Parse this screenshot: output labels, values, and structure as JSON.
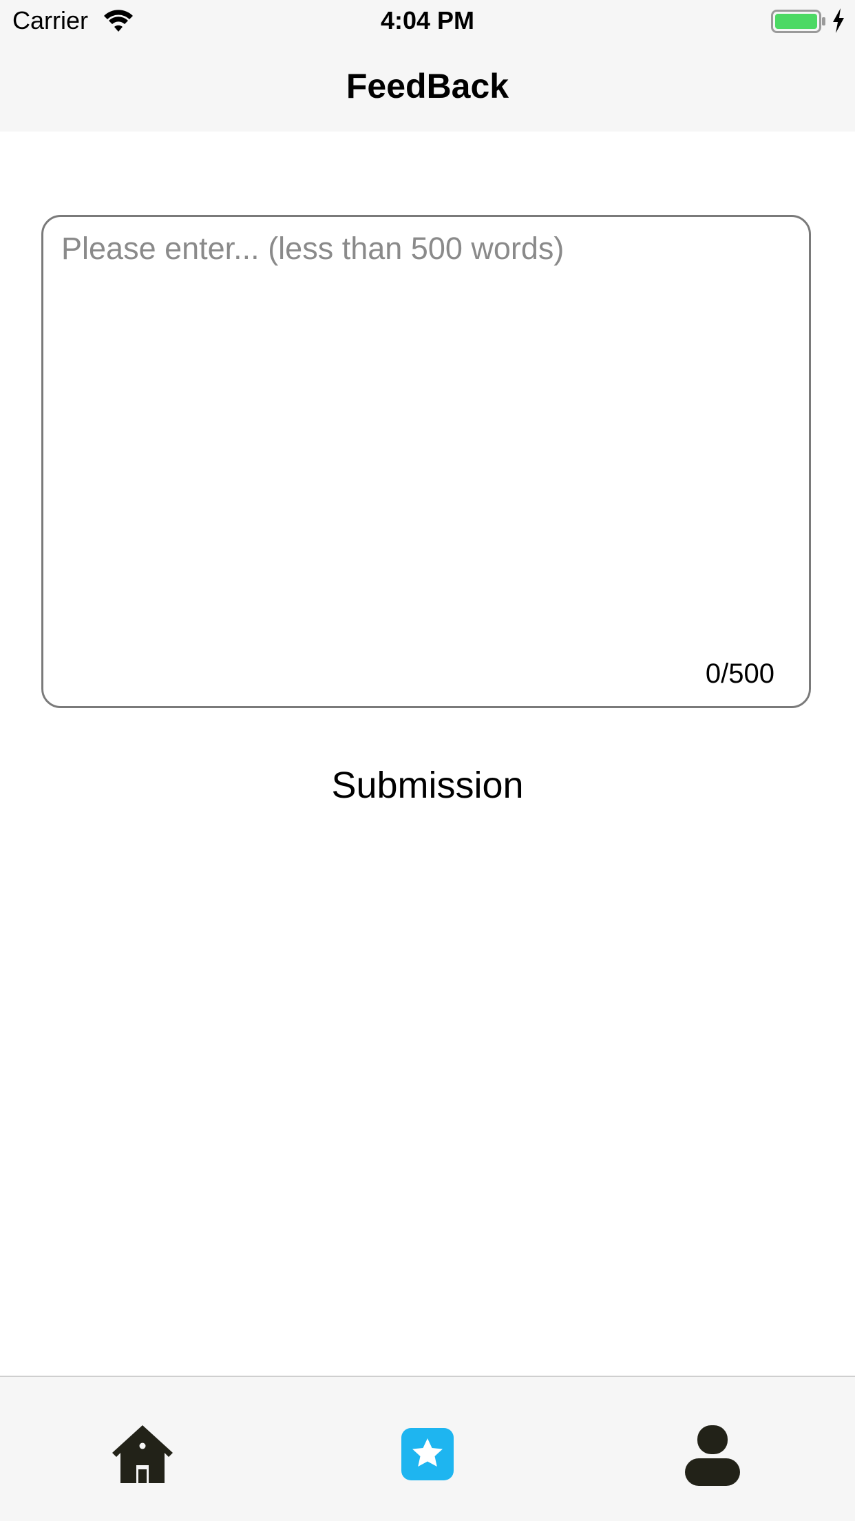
{
  "status_bar": {
    "carrier": "Carrier",
    "time": "4:04 PM",
    "icons": [
      "wifi-icon",
      "battery-icon",
      "charging-icon"
    ],
    "battery_color": "#4cd964"
  },
  "nav": {
    "title": "FeedBack"
  },
  "feedback": {
    "placeholder": "Please enter... (less than 500 words)",
    "value": "",
    "count": "0/500"
  },
  "actions": {
    "submit_label": "Submission"
  },
  "tab_bar": {
    "tabs": [
      {
        "icon": "home-icon",
        "selected": false
      },
      {
        "icon": "star-icon",
        "selected": true
      },
      {
        "icon": "profile-icon",
        "selected": false
      }
    ],
    "active_color": "#1eb5f0",
    "inactive_color": "#222218"
  }
}
